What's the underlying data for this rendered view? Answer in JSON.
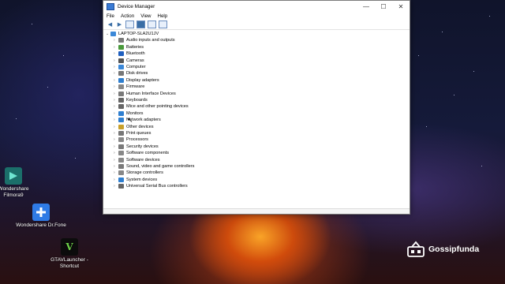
{
  "window": {
    "title": "Device Manager",
    "controls": {
      "minimize": "—",
      "maximize": "☐",
      "close": "✕"
    }
  },
  "menu": [
    "File",
    "Action",
    "View",
    "Help"
  ],
  "tree": {
    "root": "LAPTOP-SLA2U1JV",
    "items": [
      {
        "label": "Audio inputs and outputs",
        "color": "#7a7a7a"
      },
      {
        "label": "Batteries",
        "color": "#4a9a3c"
      },
      {
        "label": "Bluetooth",
        "color": "#1f5fbf"
      },
      {
        "label": "Cameras",
        "color": "#555555"
      },
      {
        "label": "Computer",
        "color": "#3b88d8"
      },
      {
        "label": "Disk drives",
        "color": "#777777"
      },
      {
        "label": "Display adapters",
        "color": "#2f7fd0"
      },
      {
        "label": "Firmware",
        "color": "#888888"
      },
      {
        "label": "Human Interface Devices",
        "color": "#7a7a7a"
      },
      {
        "label": "Keyboards",
        "color": "#666666"
      },
      {
        "label": "Mice and other pointing devices",
        "color": "#666666"
      },
      {
        "label": "Monitors",
        "color": "#2f7fd0"
      },
      {
        "label": "Network adapters",
        "color": "#2f7fd0"
      },
      {
        "label": "Other devices",
        "color": "#c8a02a"
      },
      {
        "label": "Print queues",
        "color": "#777777"
      },
      {
        "label": "Processors",
        "color": "#888888"
      },
      {
        "label": "Security devices",
        "color": "#7a7a7a"
      },
      {
        "label": "Software components",
        "color": "#888888"
      },
      {
        "label": "Software devices",
        "color": "#888888"
      },
      {
        "label": "Sound, video and game controllers",
        "color": "#7a7a7a"
      },
      {
        "label": "Storage controllers",
        "color": "#888888"
      },
      {
        "label": "System devices",
        "color": "#2f7fd0"
      },
      {
        "label": "Universal Serial Bus controllers",
        "color": "#666666"
      }
    ]
  },
  "desktop": {
    "icons": [
      {
        "label": "Wondershare Filmora9"
      },
      {
        "label": "Wondershare Dr.Fone"
      },
      {
        "label": "GTAVLauncher - Shortcut"
      }
    ],
    "watermark": "Gossipfunda"
  }
}
